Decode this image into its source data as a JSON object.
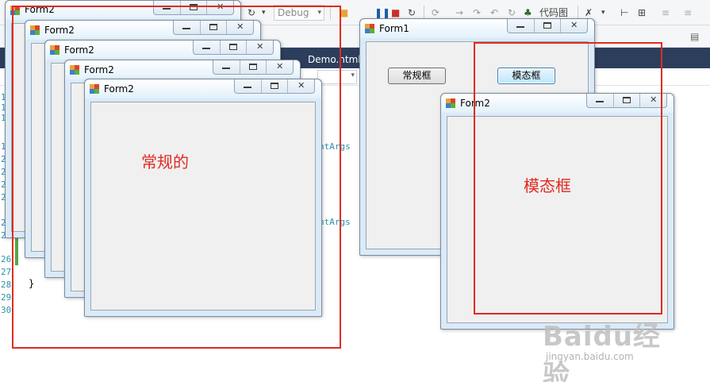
{
  "ide": {
    "config_dropdown": "Debug",
    "code_map_label": "代码图",
    "doc_tab": "Demo.html",
    "line_numbers": [
      "1",
      "1",
      "1",
      "1",
      "2",
      "2",
      "2",
      "2",
      "2",
      "2",
      "26",
      "27",
      "28",
      "29",
      "30"
    ],
    "code_fragments": [
      "ntArgs",
      "ntArgs"
    ],
    "closing_brace": "}"
  },
  "windows": {
    "regular_stack_title": "Form2",
    "form1_title": "Form1",
    "modal_title": "Form2"
  },
  "form1": {
    "regular_button": "常规框",
    "modal_button": "模态框"
  },
  "annotations": {
    "regular_label": "常规的",
    "modal_label": "模态框",
    "color": "#e02b20"
  },
  "watermark": {
    "main": "Baidu经验",
    "sub": "jingyan.baidu.com"
  }
}
